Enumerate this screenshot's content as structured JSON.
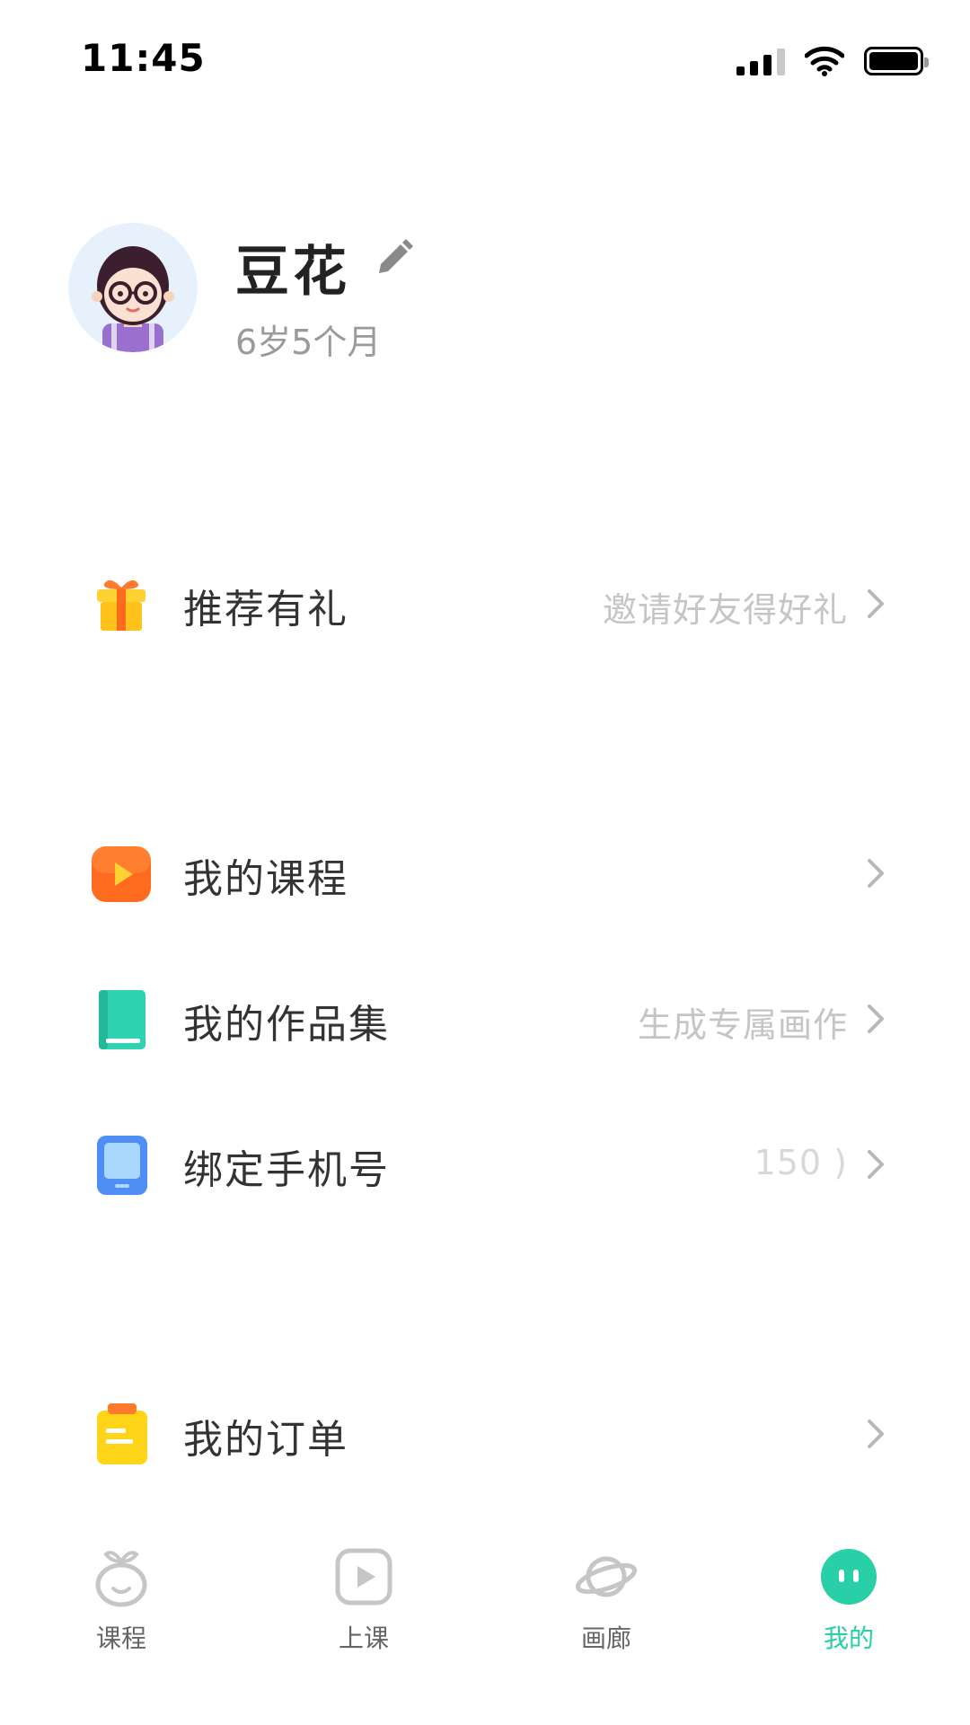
{
  "status_bar": {
    "time": "11:45"
  },
  "profile": {
    "name": "豆花",
    "age": "6岁5个月"
  },
  "menu": {
    "referral": {
      "label": "推荐有礼",
      "sub": "邀请好友得好礼"
    },
    "my_courses": {
      "label": "我的课程",
      "sub": ""
    },
    "my_works": {
      "label": "我的作品集",
      "sub": "生成专属画作"
    },
    "bind_phone": {
      "label": "绑定手机号",
      "sub": "150              )"
    },
    "my_orders": {
      "label": "我的订单",
      "sub": ""
    }
  },
  "tabs": [
    {
      "label": "课程",
      "icon": "sprout-face-icon",
      "active": false
    },
    {
      "label": "上课",
      "icon": "play-icon",
      "active": false
    },
    {
      "label": "画廊",
      "icon": "planet-icon",
      "active": false
    },
    {
      "label": "我的",
      "icon": "face-icon",
      "active": true
    }
  ],
  "colors": {
    "accent": "#29cfa6",
    "gift": "#ffd233",
    "course": "#ff6b1e",
    "works": "#2ed3b2",
    "phone": "#4f8ff5",
    "order": "#ffd51a"
  }
}
